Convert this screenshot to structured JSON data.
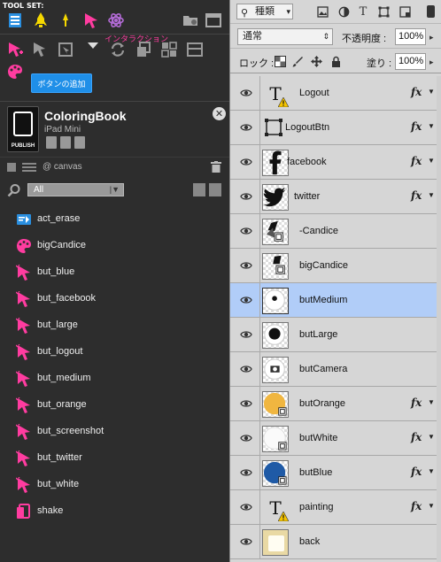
{
  "left_panel": {
    "toolset_label": "TOOL SET:",
    "interaction_label": "インタラクション",
    "add_button": "ボタンの追加",
    "project": {
      "title": "ColoringBook",
      "device": "iPad Mini",
      "publish_label": "PUBLISH"
    },
    "canvas_label": "@ canvas",
    "filter_value": "All",
    "items": [
      {
        "label": "act_erase",
        "icon": "action-icon"
      },
      {
        "label": "bigCandice",
        "icon": "palette-icon"
      },
      {
        "label": "but_blue",
        "icon": "cursor-icon"
      },
      {
        "label": "but_facebook",
        "icon": "cursor-icon"
      },
      {
        "label": "but_large",
        "icon": "cursor-icon"
      },
      {
        "label": "but_logout",
        "icon": "cursor-icon"
      },
      {
        "label": "but_medium",
        "icon": "cursor-icon"
      },
      {
        "label": "but_orange",
        "icon": "cursor-icon"
      },
      {
        "label": "but_screenshot",
        "icon": "cursor-icon"
      },
      {
        "label": "but_twitter",
        "icon": "cursor-icon"
      },
      {
        "label": "but_white",
        "icon": "cursor-icon"
      },
      {
        "label": "shake",
        "icon": "shake-icon"
      }
    ],
    "colors": {
      "accent_pink": "#ff3ca0",
      "accent_blue": "#1f8fe8",
      "accent_yellow": "#f5d800"
    }
  },
  "layers_panel": {
    "kind_filter": "種類",
    "blend_mode": "通常",
    "opacity_label": "不透明度 :",
    "opacity_value": "100%",
    "lock_label": "ロック :",
    "fill_label": "塗り :",
    "fill_value": "100%",
    "layers": [
      {
        "name": "Logout",
        "thumb": "text",
        "fx": true,
        "selected": false
      },
      {
        "name": "LogoutBtn",
        "thumb": "smart",
        "fx": true,
        "selected": false
      },
      {
        "name": "facebook",
        "thumb": "facebook",
        "fx": true,
        "selected": false
      },
      {
        "name": "twitter",
        "thumb": "twitter",
        "fx": true,
        "selected": false
      },
      {
        "name": "-Candice",
        "thumb": "candice",
        "fx": false,
        "selected": false
      },
      {
        "name": "bigCandice",
        "thumb": "candice-small",
        "fx": false,
        "selected": false
      },
      {
        "name": "butMedium",
        "thumb": "dot-medium",
        "fx": false,
        "selected": true
      },
      {
        "name": "butLarge",
        "thumb": "dot-large",
        "fx": false,
        "selected": false
      },
      {
        "name": "butCamera",
        "thumb": "camera",
        "fx": false,
        "selected": false
      },
      {
        "name": "butOrange",
        "thumb": "orange",
        "fx": true,
        "selected": false
      },
      {
        "name": "butWhite",
        "thumb": "white",
        "fx": true,
        "selected": false
      },
      {
        "name": "butBlue",
        "thumb": "blue",
        "fx": true,
        "selected": false
      },
      {
        "name": "painting",
        "thumb": "text",
        "fx": true,
        "selected": false
      },
      {
        "name": "back",
        "thumb": "back",
        "fx": false,
        "selected": false
      }
    ],
    "fx_label": "fx",
    "colors": {
      "selected_row": "#b1cdf8",
      "orange": "#f0b640",
      "blue": "#1f5aa6"
    }
  }
}
